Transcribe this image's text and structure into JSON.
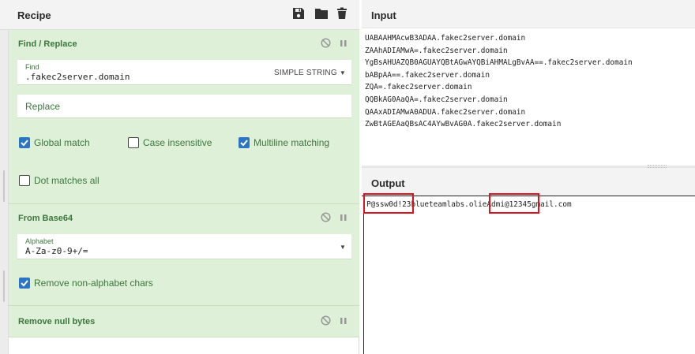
{
  "recipe": {
    "title": "Recipe",
    "operations": [
      {
        "name": "Find / Replace",
        "find_label": "Find",
        "find_value": ".fakec2server.domain",
        "find_mode": "SIMPLE STRING",
        "replace_placeholder": "Replace",
        "options": [
          {
            "label": "Global match",
            "checked": true
          },
          {
            "label": "Case insensitive",
            "checked": false
          },
          {
            "label": "Multiline matching",
            "checked": true
          },
          {
            "label": "Dot matches all",
            "checked": false
          }
        ]
      },
      {
        "name": "From Base64",
        "alphabet_label": "Alphabet",
        "alphabet_value": "A-Za-z0-9+/=",
        "remove_non_alpha": {
          "label": "Remove non-alphabet chars",
          "checked": true
        }
      },
      {
        "name": "Remove null bytes"
      }
    ]
  },
  "input": {
    "title": "Input",
    "text": "UABAAHMAcwB3ADAA.fakec2server.domain\nZAAhADIAMwA=.fakec2server.domain\nYgBsAHUAZQB0AGUAYQBtAGwAYQBiAHMALgBvAA==.fakec2server.domain\nbABpAA==.fakec2server.domain\nZQA=.fakec2server.domain\nQQBkAG0AaQA=.fakec2server.domain\nQAAxADIAMwA0ADUA.fakec2server.domain\nZwBtAGEAaQBsAC4AYwBvAG0A.fakec2server.domain"
  },
  "output": {
    "title": "Output",
    "text": "P@ssw0d!23blueteamlabs.olieAdmi@12345gmail.com"
  },
  "colors": {
    "operation_bg": "#dff0d8",
    "operation_text": "#3c763d",
    "checkbox_on": "#2c74c4",
    "highlight": "#d9141e"
  }
}
